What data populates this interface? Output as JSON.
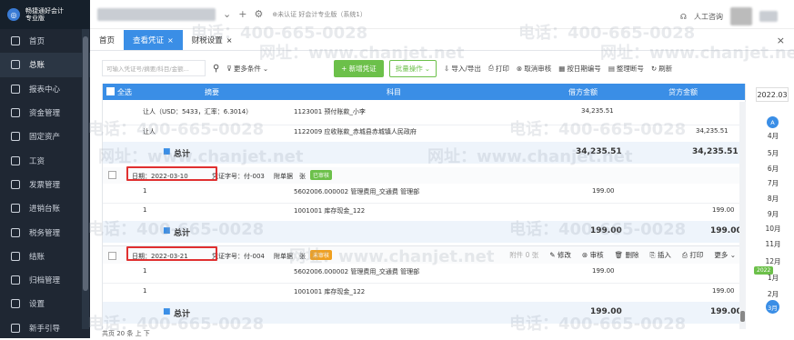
{
  "brand": {
    "line1": "畅捷通好会计",
    "line2": "专业版"
  },
  "sidebar": {
    "items": [
      {
        "label": "首页",
        "icon": "home-icon"
      },
      {
        "label": "总账",
        "icon": "ledger-icon",
        "active": true
      },
      {
        "label": "报表中心",
        "icon": "report-icon"
      },
      {
        "label": "资金管理",
        "icon": "fund-icon"
      },
      {
        "label": "固定资产",
        "icon": "asset-icon"
      },
      {
        "label": "工资",
        "icon": "salary-icon"
      },
      {
        "label": "发票管理",
        "icon": "invoice-icon"
      },
      {
        "label": "进销台账",
        "icon": "inventory-icon"
      },
      {
        "label": "税务管理",
        "icon": "tax-icon"
      },
      {
        "label": "结账",
        "icon": "close-books-icon"
      },
      {
        "label": "归档管理",
        "icon": "archive-icon"
      },
      {
        "label": "设置",
        "icon": "settings-icon"
      },
      {
        "label": "新手引导",
        "icon": "guide-icon"
      }
    ]
  },
  "topbar": {
    "plus": "+",
    "cert_text": "⊕未认证 好会计专业版（系统1）",
    "support": "人工咨询"
  },
  "tabs": [
    {
      "label": "首页",
      "closable": false
    },
    {
      "label": "查看凭证",
      "closable": true,
      "active": true
    },
    {
      "label": "财税设置",
      "closable": true
    }
  ],
  "toolbar": {
    "search_placeholder": "可输入凭证号/摘要/科目/金额...",
    "more_filter": "更多条件",
    "new_voucher": "+ 新增凭证",
    "batch": "批量操作",
    "import_export": "导入/导出",
    "print": "打印",
    "cancel_audit": "取消审核",
    "by_date": "按日期编号",
    "renumber": "整理断号",
    "refresh": "刷新"
  },
  "grid_header": {
    "select_all": "全选",
    "summary": "摘要",
    "subject": "科目",
    "debit": "借方金额",
    "credit": "贷方金额"
  },
  "voucher1": {
    "lines": [
      {
        "summary": "让人（USD：5433，汇率：6.3014）",
        "subject": "1123001 预付账款_小李",
        "debit": "34,235.51",
        "credit": ""
      },
      {
        "summary": "让人",
        "subject": "1122009 应收账款_赤城县赤城镇人民政府",
        "debit": "",
        "credit": "34,235.51"
      }
    ],
    "total_label": "总计",
    "total_debit": "34,235.51",
    "total_credit": "34,235.51"
  },
  "voucher2": {
    "date": "日期：2022-03-10",
    "voucher_no": "凭证字号：付-003",
    "attach": "附单据",
    "maker": "张",
    "status": "已审核",
    "lines": [
      {
        "summary": "1",
        "subject": "5602006.000002 管理费用_交通费 管理部",
        "debit": "199.00",
        "credit": ""
      },
      {
        "summary": "1",
        "subject": "1001001 库存现金_122",
        "debit": "",
        "credit": "199.00"
      }
    ],
    "total_label": "总计",
    "total_debit": "199.00",
    "total_credit": "199.00"
  },
  "voucher3": {
    "date": "日期：2022-03-21",
    "voucher_no": "凭证字号：付-004",
    "attach": "附单据",
    "maker": "张",
    "status": "未审核",
    "actions": [
      "附件 0 张",
      "修改",
      "审核",
      "删除",
      "插入",
      "打印",
      "更多"
    ],
    "lines": [
      {
        "summary": "1",
        "subject": "5602006.000002 管理费用_交通费 管理部",
        "debit": "199.00",
        "credit": ""
      },
      {
        "summary": "1",
        "subject": "1001001 库存现金_122",
        "debit": "",
        "credit": "199.00"
      }
    ],
    "total_label": "总计",
    "total_debit": "199.00",
    "total_credit": "199.00"
  },
  "right_panel": {
    "year": "2022.03",
    "months": [
      "4月",
      "5月",
      "6月",
      "7月",
      "8月",
      "9月",
      "10月",
      "11月",
      "12月",
      "1月",
      "2月",
      "3月"
    ],
    "year_tag": "2022",
    "bubble_a": "A",
    "active_month": "3月"
  },
  "footer": {
    "text": "共页 20 条 上 下"
  },
  "watermark": {
    "phone": "电话：400-665-0028",
    "site": "网址：www.chanjet.net"
  },
  "colors": {
    "primary": "#3a8ee6",
    "green": "#6cc04a",
    "red": "#e03030",
    "sidebar": "#1f2733"
  }
}
